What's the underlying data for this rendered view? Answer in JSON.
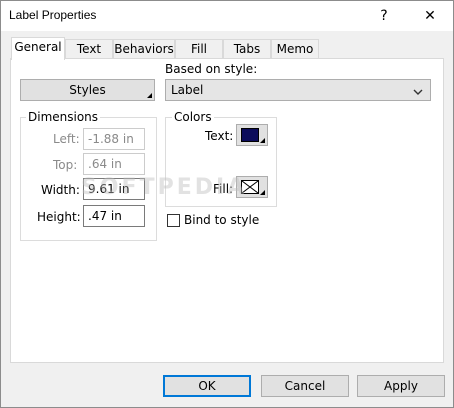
{
  "window": {
    "title": "Label Properties",
    "help_glyph": "?",
    "close_glyph": "✕"
  },
  "tabs": [
    {
      "label": "General",
      "active": true
    },
    {
      "label": "Text"
    },
    {
      "label": "Behaviors"
    },
    {
      "label": "Fill"
    },
    {
      "label": "Tabs"
    },
    {
      "label": "Memo"
    }
  ],
  "general": {
    "styles_button": "Styles",
    "based_on_label": "Based on style:",
    "based_on_value": "Label",
    "dropdown_glyph": "⌄",
    "dimensions": {
      "title": "Dimensions",
      "left_label": "Left:",
      "left_value": "-1.88 in",
      "top_label": "Top:",
      "top_value": ".64 in",
      "width_label": "Width:",
      "width_value": "9.61 in",
      "height_label": "Height:",
      "height_value": ".47 in"
    },
    "colors": {
      "title": "Colors",
      "text_label": "Text:",
      "text_color": "#0b0b5a",
      "fill_label": "Fill:"
    },
    "bind_to_style": "Bind to style",
    "bind_checked": false
  },
  "footer": {
    "ok": "OK",
    "cancel": "Cancel",
    "apply": "Apply"
  },
  "watermark": "SOFTPEDIA"
}
